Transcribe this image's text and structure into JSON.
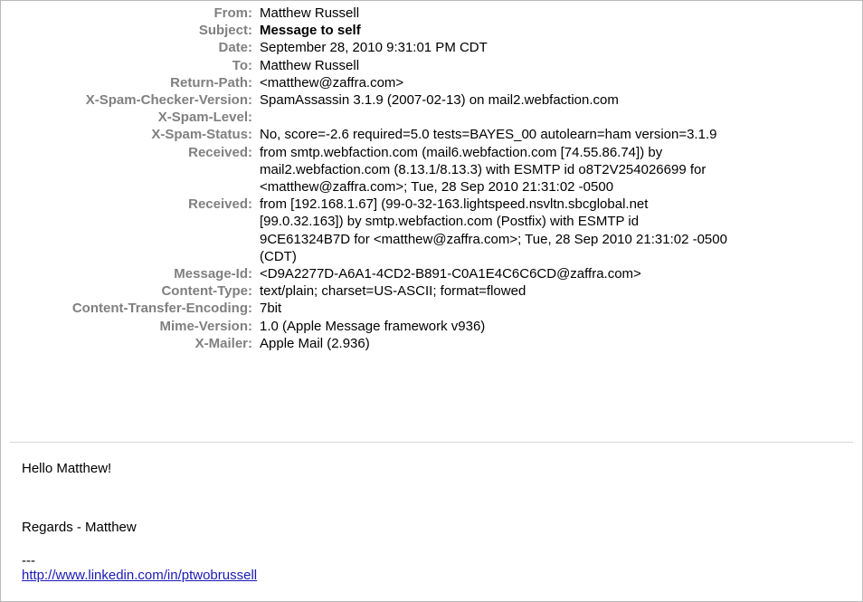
{
  "headers": [
    {
      "label": "From:",
      "value": "Matthew Russell"
    },
    {
      "label": "Subject:",
      "value": "Message to self"
    },
    {
      "label": "Date:",
      "value": "September 28, 2010 9:31:01 PM CDT"
    },
    {
      "label": "To:",
      "value": "Matthew Russell"
    },
    {
      "label": "Return-Path:",
      "value": "<matthew@zaffra.com>"
    },
    {
      "label": "X-Spam-Checker-Version:",
      "value": "SpamAssassin 3.1.9 (2007-02-13) on mail2.webfaction.com"
    },
    {
      "label": "X-Spam-Level:",
      "value": ""
    },
    {
      "label": "X-Spam-Status:",
      "value": "No, score=-2.6 required=5.0 tests=BAYES_00 autolearn=ham version=3.1.9"
    },
    {
      "label": "Received:",
      "value": "from smtp.webfaction.com (mail6.webfaction.com [74.55.86.74]) by\nmail2.webfaction.com (8.13.1/8.13.3) with ESMTP id o8T2V254026699 for\n<matthew@zaffra.com>; Tue, 28 Sep 2010 21:31:02 -0500"
    },
    {
      "label": "Received:",
      "value": "from [192.168.1.67] (99-0-32-163.lightspeed.nsvltn.sbcglobal.net\n[99.0.32.163]) by smtp.webfaction.com (Postfix) with ESMTP id\n9CE61324B7D for <matthew@zaffra.com>; Tue, 28 Sep 2010 21:31:02 -0500\n(CDT)"
    },
    {
      "label": "Message-Id:",
      "value": "<D9A2277D-A6A1-4CD2-B891-C0A1E4C6C6CD@zaffra.com>"
    },
    {
      "label": "Content-Type:",
      "value": "text/plain; charset=US-ASCII; format=flowed"
    },
    {
      "label": "Content-Transfer-Encoding:",
      "value": "7bit"
    },
    {
      "label": "Mime-Version:",
      "value": "1.0 (Apple Message framework v936)"
    },
    {
      "label": "X-Mailer:",
      "value": "Apple Mail (2.936)"
    }
  ],
  "body": {
    "greeting": "Hello Matthew!",
    "closing": "Regards - Matthew",
    "signature_separator": "---",
    "signature_link": "http://www.linkedin.com/in/ptwobrussell"
  }
}
